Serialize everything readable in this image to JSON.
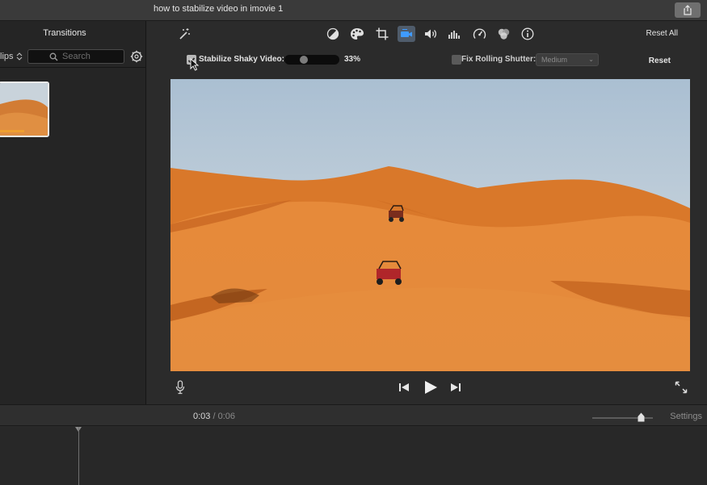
{
  "window": {
    "title": "how to stabilize video in imovie 1"
  },
  "left_panel": {
    "tab_label": "Transitions",
    "clips_filter": "lips",
    "search_placeholder": "Search"
  },
  "adjust_toolbar": {
    "icons": [
      "magic-wand-icon",
      "color-balance-icon",
      "color-correction-icon",
      "crop-icon",
      "stabilization-icon",
      "volume-icon",
      "equalizer-icon",
      "speed-icon",
      "clip-filter-icon",
      "info-icon"
    ],
    "active_tool": "stabilization-icon",
    "reset_all_label": "Reset All"
  },
  "stabilization": {
    "stabilize_checked": true,
    "stabilize_label": "Stabilize Shaky Video:",
    "stabilize_amount": 0.33,
    "stabilize_value_text": "33%",
    "rolling_shutter_checked": false,
    "rolling_shutter_label": "Fix Rolling Shutter:",
    "rolling_shutter_option": "Medium",
    "reset_label": "Reset"
  },
  "timeline_bar": {
    "current_time": "0:03",
    "separator": "/",
    "total_time": "0:06",
    "zoom_level": 0.8,
    "settings_label": "Settings"
  },
  "colors": {
    "sky": "#bfd0de",
    "sand": "#e08535",
    "active_tool_bg": "#4f5c6b"
  }
}
